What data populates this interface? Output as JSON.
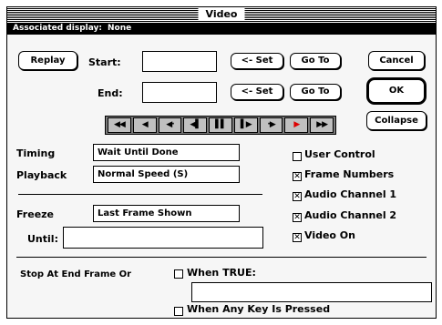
{
  "window": {
    "title": "Video"
  },
  "info": {
    "label": "Associated display:",
    "value": "None"
  },
  "buttons": {
    "replay": "Replay",
    "set": "<- Set",
    "goto": "Go To",
    "cancel": "Cancel",
    "ok": "OK",
    "collapse": "Collapse"
  },
  "labels": {
    "start": "Start:",
    "end": "End:"
  },
  "transport": [
    "◀◀",
    "◀",
    "◀·",
    "◀▌",
    "▌▌",
    "▌▶",
    "·▶",
    "▶",
    "▶▶"
  ],
  "timing": {
    "label": "Timing",
    "value": "Wait Until Done"
  },
  "playback": {
    "label": "Playback",
    "value": "Normal Speed (S)"
  },
  "freeze": {
    "label": "Freeze",
    "value": "Last Frame Shown"
  },
  "until": {
    "label": "Until:"
  },
  "options": [
    {
      "label": "User Control",
      "checked": false
    },
    {
      "label": "Frame Numbers",
      "checked": true
    },
    {
      "label": "Audio Channel 1",
      "checked": true
    },
    {
      "label": "Audio Channel 2",
      "checked": true
    },
    {
      "label": "Video On",
      "checked": true
    }
  ],
  "stop": {
    "label": "Stop At End Frame Or",
    "when_true": "When TRUE:",
    "any_key": "When Any Key Is Pressed",
    "when_true_checked": false,
    "any_key_checked": false
  },
  "check_mark": "✕"
}
